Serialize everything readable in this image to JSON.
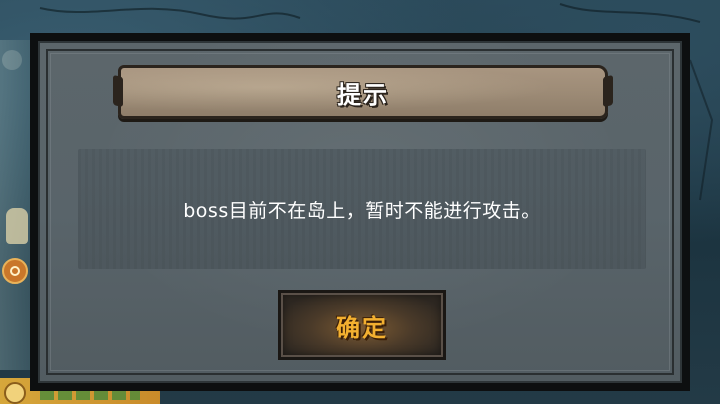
{
  "dialog": {
    "title": "提示",
    "message": "boss目前不在岛上，暂时不能进行攻击。",
    "confirm_label": "确定"
  },
  "colors": {
    "dialog_background": "#5c666b",
    "title_plank": "#9d8b76",
    "confirm_text": "#f3b030",
    "backdrop": "#1f3340"
  }
}
